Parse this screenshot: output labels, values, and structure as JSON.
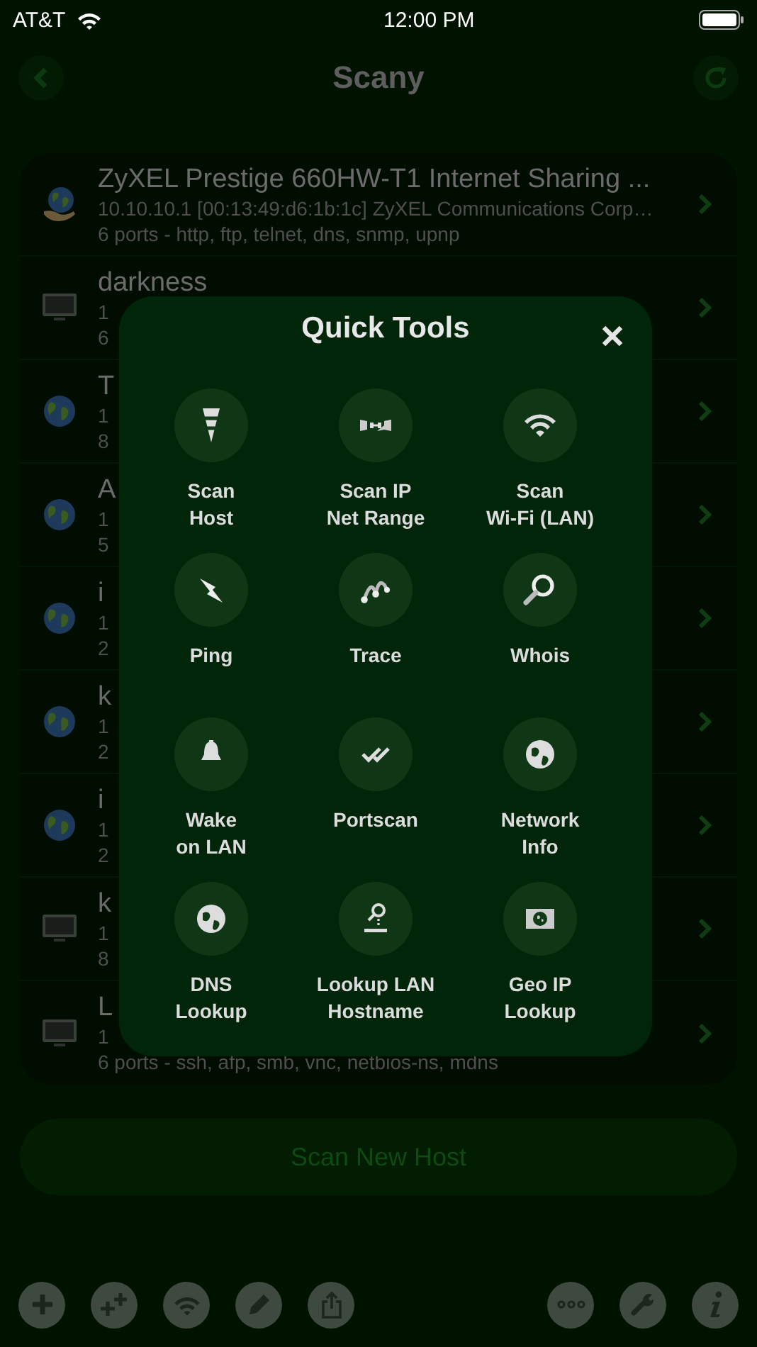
{
  "status_bar": {
    "carrier": "AT&T",
    "time": "12:00 PM"
  },
  "nav": {
    "title": "Scany"
  },
  "hosts": [
    {
      "kind": "globe-hand",
      "name": "ZyXEL Prestige 660HW-T1 Internet Sharing ...",
      "line_2": "10.10.10.1 [00:13:49:d6:1b:1c] ZyXEL Communications Corp…",
      "line_3": "6 ports - http, ftp, telnet, dns, snmp, upnp"
    },
    {
      "kind": "monitor",
      "name": "darkness",
      "line_2": "1",
      "line_3": "6"
    },
    {
      "kind": "globe",
      "name": "T",
      "line_2": "1",
      "line_3": "8"
    },
    {
      "kind": "globe",
      "name": "A",
      "line_2": "1",
      "line_3": "5"
    },
    {
      "kind": "globe",
      "name": "i",
      "line_2": "1",
      "line_3": "2"
    },
    {
      "kind": "globe",
      "name": "k",
      "line_2": "1",
      "line_3": "2"
    },
    {
      "kind": "globe",
      "name": "i",
      "line_2": "1",
      "line_3": "2"
    },
    {
      "kind": "monitor",
      "name": "k",
      "line_2": "1",
      "line_3": "8"
    },
    {
      "kind": "monitor",
      "name": "L",
      "line_2": "1",
      "line_3": "6 ports - ssh, afp, smb, vnc, netbios-ns, mdns"
    }
  ],
  "scan_button": "Scan New Host",
  "quick_tools": {
    "title": "Quick Tools",
    "tools": [
      {
        "lines": [
          "Scan",
          "Host"
        ]
      },
      {
        "lines": [
          "Scan IP",
          "Net Range"
        ]
      },
      {
        "lines": [
          "Scan",
          "Wi-Fi (LAN)"
        ]
      },
      {
        "lines": [
          "Ping"
        ]
      },
      {
        "lines": [
          "Trace"
        ]
      },
      {
        "lines": [
          "Whois"
        ]
      },
      {
        "lines": [
          "Wake",
          "on LAN"
        ]
      },
      {
        "lines": [
          "Portscan"
        ]
      },
      {
        "lines": [
          "Network",
          "Info"
        ]
      },
      {
        "lines": [
          "DNS",
          "Lookup"
        ]
      },
      {
        "lines": [
          "Lookup LAN",
          "Hostname"
        ]
      },
      {
        "lines": [
          "Geo IP",
          "Lookup"
        ]
      }
    ]
  }
}
